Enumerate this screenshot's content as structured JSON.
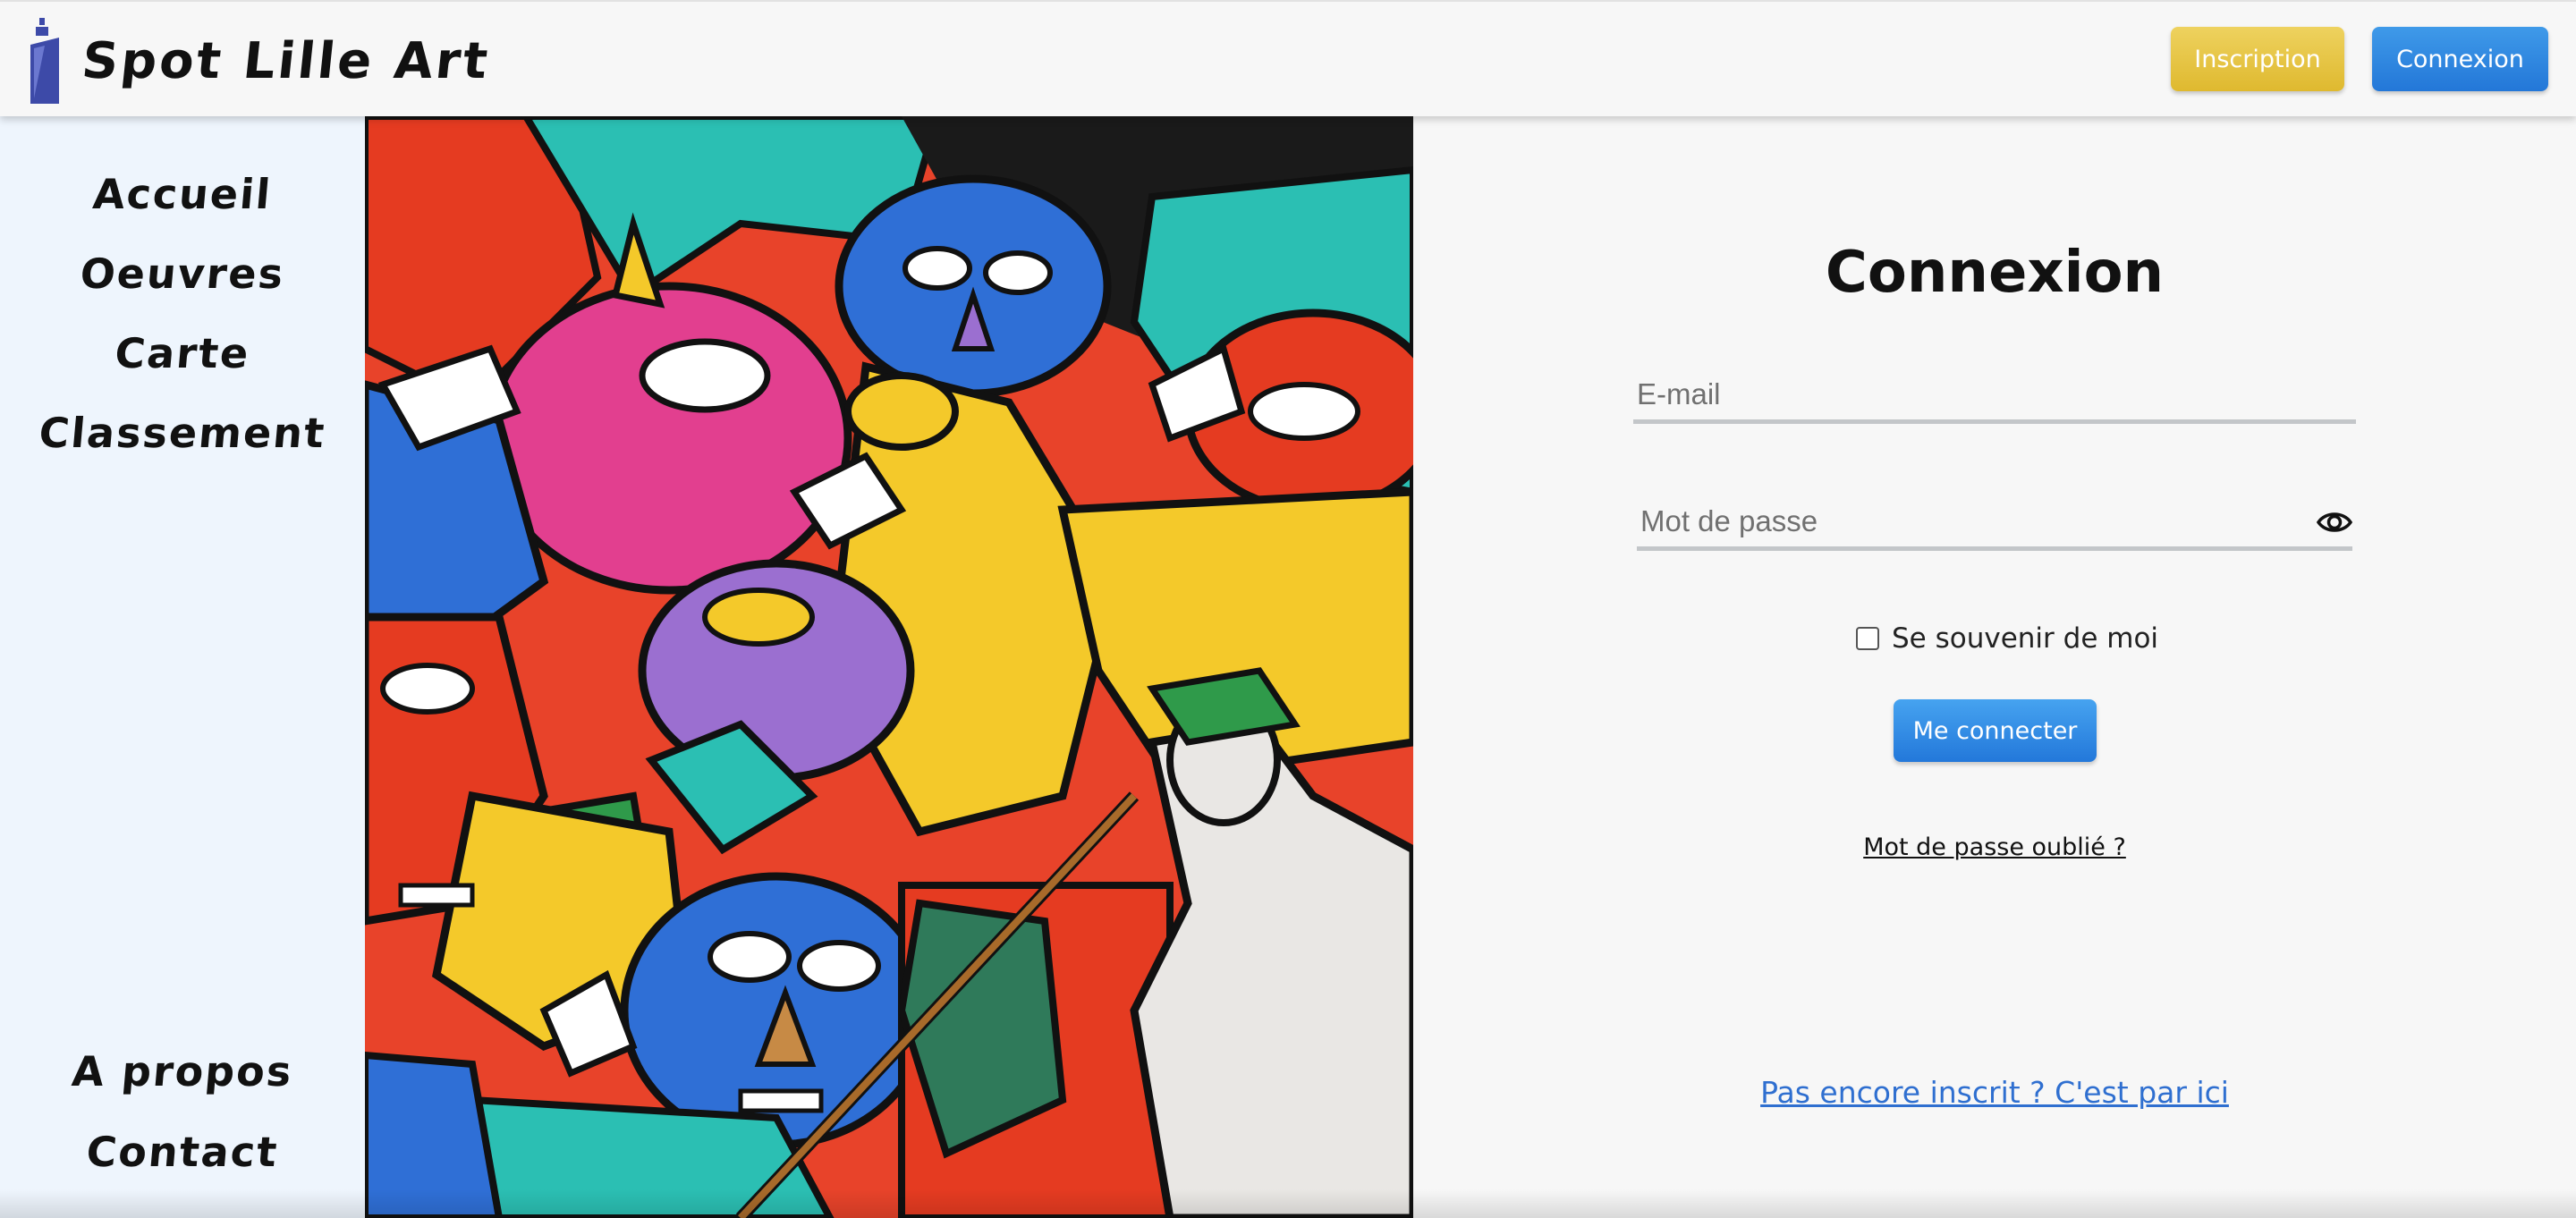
{
  "header": {
    "site_title": "Spot Lille Art",
    "inscription_label": "Inscription",
    "connexion_label": "Connexion"
  },
  "sidebar": {
    "items": [
      {
        "label": "Accueil"
      },
      {
        "label": "Oeuvres"
      },
      {
        "label": "Carte"
      },
      {
        "label": "Classement"
      },
      {
        "label": "A propos"
      },
      {
        "label": "Contact"
      }
    ]
  },
  "login": {
    "title": "Connexion",
    "email_placeholder": "E-mail",
    "password_placeholder": "Mot de passe",
    "remember_label": "Se souvenir de moi",
    "submit_label": "Me connecter",
    "forgot_label": "Mot de passe oublié ?",
    "signup_label": "Pas encore inscrit ? C'est par ici"
  },
  "icons": {
    "logo": "spray-can-icon",
    "password_toggle": "eye-icon"
  },
  "colors": {
    "inscription": "#e3c03f",
    "connexion": "#2a82df",
    "link": "#2f6fd0",
    "sidebar_bg": "#eef5fd"
  }
}
